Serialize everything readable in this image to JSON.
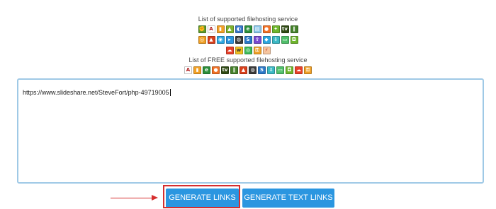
{
  "supported": {
    "caption": "List of supported filehosting service",
    "rows": [
      [
        {
          "icon": "fist-icon",
          "color": "#5e9a2b",
          "glyph": "✊"
        },
        {
          "icon": "letter-a-icon",
          "color": "#ffffff",
          "glyph": "A",
          "fg": "#b01818"
        },
        {
          "icon": "bookmark-icon",
          "color": "#f0a026",
          "glyph": "▮"
        },
        {
          "icon": "android-icon",
          "color": "#7db22d",
          "glyph": "▲"
        },
        {
          "icon": "mediafire-icon",
          "color": "#3a78c9",
          "glyph": "◐"
        },
        {
          "icon": "letter-e-icon",
          "color": "#2c8e3a",
          "glyph": "e"
        },
        {
          "icon": "file-icon",
          "color": "#8ac6e8",
          "glyph": "▤"
        },
        {
          "icon": "red-circle-icon",
          "color": "#f07126",
          "glyph": "●"
        },
        {
          "icon": "bird-icon",
          "color": "#6eb52c",
          "glyph": "✦"
        },
        {
          "icon": "tv-icon",
          "color": "#2f4a14",
          "glyph": "tv"
        },
        {
          "icon": "audio-icon",
          "color": "#44802a",
          "glyph": "∥"
        }
      ],
      [
        {
          "icon": "target-icon",
          "color": "#f0a026",
          "glyph": "◎"
        },
        {
          "icon": "rocket-icon",
          "color": "#d8401c",
          "glyph": "▲"
        },
        {
          "icon": "globe-icon",
          "color": "#2ba6e0",
          "glyph": "◉"
        },
        {
          "icon": "play-icon",
          "color": "#2b96e0",
          "glyph": "▸"
        },
        {
          "icon": "search-icon",
          "color": "#3a3a3a",
          "glyph": "◍"
        },
        {
          "icon": "letter-s-icon",
          "color": "#2a78c8",
          "glyph": "S"
        },
        {
          "icon": "upload-icon",
          "color": "#7a4ad0",
          "glyph": "⇪"
        },
        {
          "icon": "shield-icon",
          "color": "#2ba6e0",
          "glyph": "◆"
        },
        {
          "icon": "download-icon",
          "color": "#3bb8c4",
          "glyph": "⇩"
        },
        {
          "icon": "screen-icon",
          "color": "#4fbf6a",
          "glyph": "▭"
        },
        {
          "icon": "box-icon",
          "color": "#6eb52c",
          "glyph": "◘"
        }
      ],
      [
        {
          "icon": "cloud-icon",
          "color": "#e8412a",
          "glyph": "☁"
        },
        {
          "icon": "letter-w-icon",
          "color": "#f0c020",
          "glyph": "w",
          "fg": "#333333"
        },
        {
          "icon": "chat-icon",
          "color": "#3cba5a",
          "glyph": "◎"
        },
        {
          "icon": "key-icon",
          "color": "#f0a026",
          "glyph": "⚿"
        },
        {
          "icon": "bolt-icon",
          "color": "#f6c6a0",
          "glyph": "⚡",
          "fg": "#c0392b"
        }
      ]
    ]
  },
  "free": {
    "caption": "List of FREE supported filehosting service",
    "rows": [
      [
        {
          "icon": "letter-a-icon",
          "color": "#ffffff",
          "glyph": "A",
          "fg": "#b01818"
        },
        {
          "icon": "bookmark-icon",
          "color": "#f0a026",
          "glyph": "▮"
        },
        {
          "icon": "letter-e-icon",
          "color": "#2c8e3a",
          "glyph": "e"
        },
        {
          "icon": "red-circle-icon",
          "color": "#f07126",
          "glyph": "●"
        },
        {
          "icon": "tv-icon",
          "color": "#2f4a14",
          "glyph": "tv"
        },
        {
          "icon": "audio-icon",
          "color": "#44802a",
          "glyph": "∥"
        },
        {
          "icon": "rocket-icon",
          "color": "#d8401c",
          "glyph": "▲"
        },
        {
          "icon": "search-icon",
          "color": "#3a3a3a",
          "glyph": "◍"
        },
        {
          "icon": "letter-s-icon",
          "color": "#2a78c8",
          "glyph": "S"
        },
        {
          "icon": "download-icon",
          "color": "#3bb8c4",
          "glyph": "⇩"
        },
        {
          "icon": "screen-icon",
          "color": "#4fbf6a",
          "glyph": "▭"
        },
        {
          "icon": "box-icon",
          "color": "#6eb52c",
          "glyph": "◘"
        },
        {
          "icon": "cloud-icon",
          "color": "#e8412a",
          "glyph": "☁"
        },
        {
          "icon": "key-icon",
          "color": "#f0a026",
          "glyph": "⚿"
        }
      ]
    ]
  },
  "links_input": {
    "value": "https://www.slideshare.net/SteveFort/php-49719005"
  },
  "buttons": {
    "generate_links": "GENERATE LINKS",
    "generate_text_links": "GENERATE TEXT LINKS"
  },
  "colors": {
    "button_bg": "#2b96e0",
    "highlight": "#d62e2e",
    "textarea_border": "#9fc9e6"
  }
}
